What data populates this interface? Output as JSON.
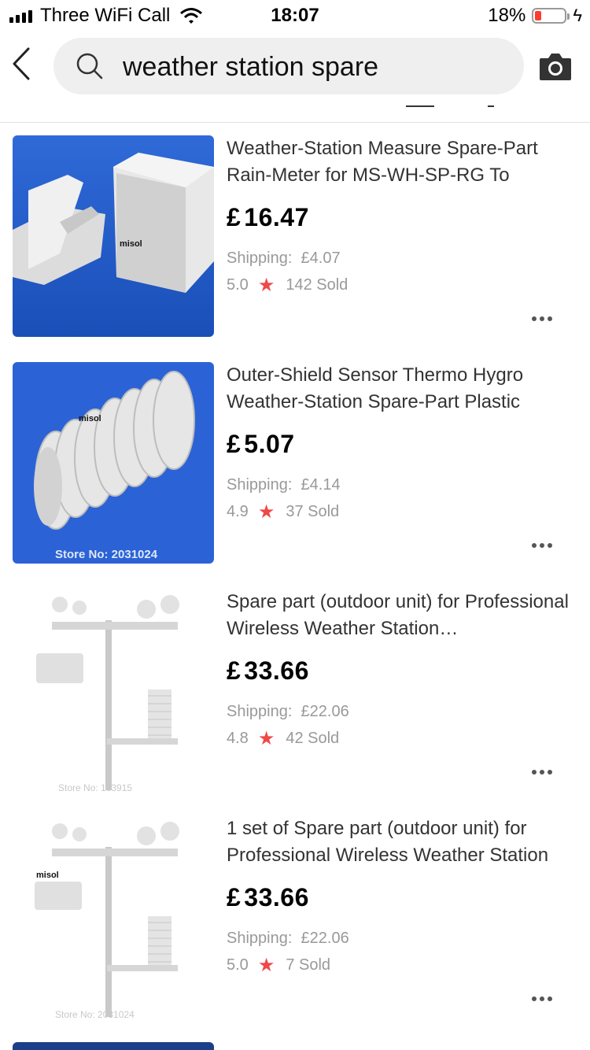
{
  "status_bar": {
    "carrier": "Three WiFi Call",
    "time": "18:07",
    "battery": "18%"
  },
  "search": {
    "query": "weather station spare",
    "icon": "search-icon"
  },
  "products": [
    {
      "title": "Weather-Station Measure Spare-Part Rain-Meter for MS-WH-SP-RG To",
      "currency": "£",
      "price": "16.47",
      "shipping_label": "Shipping:",
      "shipping": "£4.07",
      "rating": "5.0",
      "sold": "142 Sold",
      "image_text": "misol"
    },
    {
      "title": "Outer-Shield Sensor Thermo Hygro Weather-Station Spare-Part Plastic",
      "currency": "£",
      "price": "5.07",
      "shipping_label": "Shipping:",
      "shipping": "£4.14",
      "rating": "4.9",
      "sold": "37 Sold",
      "image_text": "misol",
      "image_store": "Store No: 2031024"
    },
    {
      "title": "Spare part (outdoor unit) for Professional Wireless Weather Station…",
      "currency": "£",
      "price": "33.66",
      "shipping_label": "Shipping:",
      "shipping": "£22.06",
      "rating": "4.8",
      "sold": "42 Sold",
      "image_store": "Store No: 103915"
    },
    {
      "title": "1 set of Spare part (outdoor unit) for Professional Wireless Weather Station",
      "currency": "£",
      "price": "33.66",
      "shipping_label": "Shipping:",
      "shipping": "£22.06",
      "rating": "5.0",
      "sold": "7 Sold",
      "image_text": "misol",
      "image_store": "Store No: 2031024"
    }
  ],
  "colors": {
    "star": "#f04848",
    "battery_low": "#ff3b30",
    "search_bg": "#efefef",
    "muted_text": "#999999"
  }
}
